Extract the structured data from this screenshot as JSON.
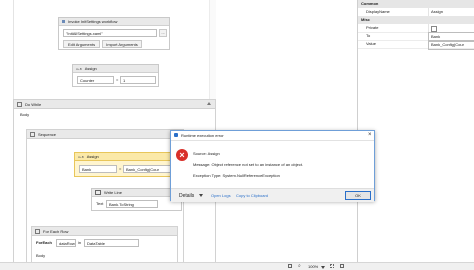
{
  "invoke": {
    "title": "Invoke InitSettings workflow",
    "path": "\"InitAllSettings.xaml\"",
    "browse": "...",
    "edit_args": "Edit Arguments",
    "import_args": "Import Arguments"
  },
  "assign1": {
    "title": "Assign",
    "to": "Counter",
    "eq": "=",
    "value": "1"
  },
  "dowhile": {
    "title": "Do While",
    "body": "Body"
  },
  "sequence": {
    "title": "Sequence"
  },
  "assign2": {
    "title": "Assign",
    "to": "Bank",
    "eq": "=",
    "value": "Bank_Config(Cour"
  },
  "writeline": {
    "title": "Write Line",
    "label": "Text",
    "value": "Bank.ToString"
  },
  "foreach": {
    "title": "For Each Row",
    "foreach_label": "ForEach",
    "item": "dataRow",
    "in_label": "in",
    "collection": "DataTable",
    "body": "Body"
  },
  "properties": {
    "rows": [
      {
        "type": "cat",
        "label": "Common"
      },
      {
        "type": "row",
        "key": "DisplayName",
        "value": "Assign"
      },
      {
        "type": "cat",
        "label": "Misc"
      },
      {
        "type": "row",
        "key": "Private",
        "value": ""
      },
      {
        "type": "row",
        "key": "To",
        "value": "Bank"
      },
      {
        "type": "row",
        "key": "Value",
        "value": "Bank_Config(Cour"
      }
    ]
  },
  "dialog": {
    "title": "Runtime execution error",
    "source": "Source: Assign",
    "message": "Message: Object reference not set to an instance of an object.",
    "exception": "Exception Type: System.NullReferenceException",
    "details": "Details",
    "open_logs": "Open Logs",
    "copy": "Copy to Clipboard",
    "ok": "OK"
  },
  "status": {
    "zoom": "100%"
  },
  "colors": {
    "error_red": "#d9302a",
    "link_blue": "#2a6fc9",
    "highlight": "#fbe9a8"
  }
}
